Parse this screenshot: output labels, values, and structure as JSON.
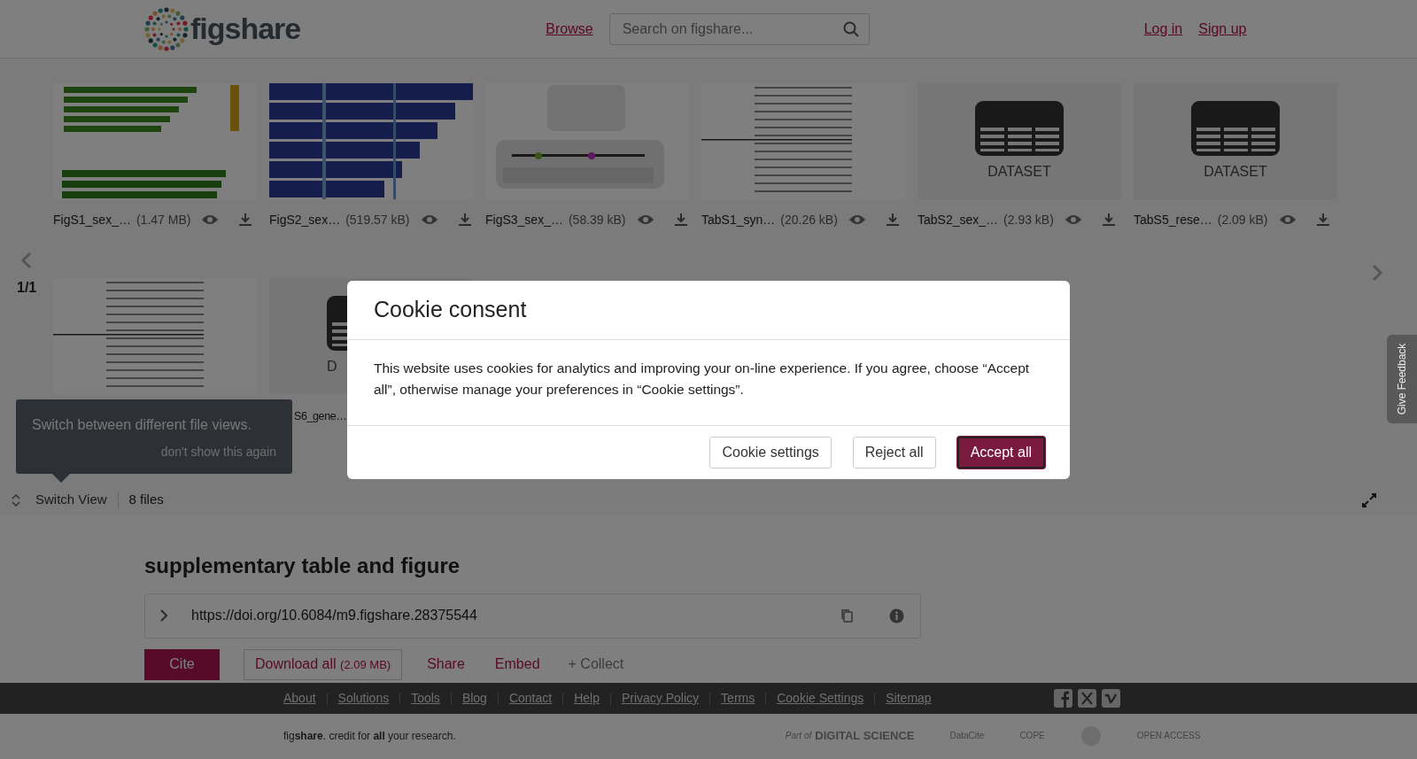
{
  "header": {
    "logo_text": "figshare",
    "browse": "Browse",
    "search": {
      "placeholder": "Search on figshare..."
    },
    "login": "Log in",
    "signup": "Sign up"
  },
  "gallery": {
    "page": "1/1",
    "rows": [
      [
        {
          "kind": "picture",
          "name": "FigS1_sex_…",
          "size": "(1.47 MB)"
        },
        {
          "kind": "picture",
          "name": "FigS2_sex…",
          "size": "(519.57 kB)"
        },
        {
          "kind": "picture",
          "name": "FigS3_sex_…",
          "size": "(58.39 kB)"
        },
        {
          "kind": "picture",
          "name": "TabS1_syn…",
          "size": "(20.26 kB)"
        },
        {
          "kind": "dataset",
          "caption": "DATASET",
          "name": "TabS2_sex_…",
          "size": "(2.93 kB)"
        },
        {
          "kind": "dataset",
          "caption": "DATASET",
          "name": "TabS5_rese…",
          "size": "(2.09 kB)"
        }
      ],
      [
        {
          "kind": "picture"
        },
        {
          "kind": "dataset",
          "caption": "D",
          "name": "S6_gene…"
        }
      ]
    ]
  },
  "tooltip": {
    "text": "Switch between different file views.",
    "dismiss": "don't show this again"
  },
  "toolbar": {
    "switch_view": "Switch View",
    "count": "8 files"
  },
  "item": {
    "title": "supplementary table and figure",
    "doi": "https://doi.org/10.6084/m9.figshare.28375544",
    "cite": "Cite",
    "download": "Download all",
    "download_size": "(2.09 MB)",
    "share": "Share",
    "embed": "Embed",
    "collect": "+ Collect"
  },
  "footer": {
    "links": [
      "About",
      "Solutions",
      "Tools",
      "Blog",
      "Contact",
      "Help",
      "Privacy Policy",
      "Terms",
      "Cookie Settings",
      "Sitemap"
    ],
    "tagline": "fig**share**. credit for **all** your research.",
    "partners": [
      "Part of",
      "DIGITAL SCIENCE",
      "DataCite",
      "COPE",
      "OPEN ACCESS"
    ]
  },
  "feedback": "Give Feedback",
  "cookie_modal": {
    "title": "Cookie consent",
    "body": "This website uses cookies for analytics and improving your on-line experience. If you agree, choose “Accept all”, otherwise manage your preferences in “Cookie settings”.",
    "buttons": [
      {
        "label": "Cookie settings",
        "primary": false
      },
      {
        "label": "Reject all",
        "primary": false
      },
      {
        "label": "Accept all",
        "primary": true
      }
    ]
  }
}
